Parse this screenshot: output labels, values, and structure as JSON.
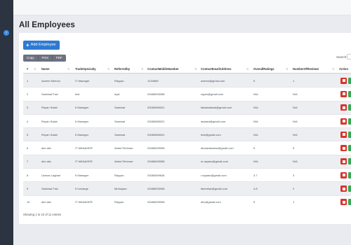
{
  "page": {
    "title": "All Employees"
  },
  "toolbar": {
    "add_label": "Add Employee",
    "exports": [
      "Copy",
      "Print",
      "PDF"
    ],
    "search_label": "Search:"
  },
  "table": {
    "headers": [
      "#",
      "Name",
      "TradeSpecialty",
      "Referredby",
      "ContactMobileNumber",
      "ContactEmailAddress",
      "OverallRatings",
      "NumberOfReviews",
      "Action"
    ],
    "rows": [
      [
        "1",
        "Azeem Memon",
        "IT Manager",
        "Rayyan",
        "1234565",
        "azeem@gmail.com",
        "5",
        "1"
      ],
      [
        "2",
        "Samiwal Faiz",
        "test",
        "riyal",
        "03486005058",
        "rayan@gmail.com",
        "N/A",
        "N/A"
      ],
      [
        "3",
        "Reyan Salah",
        "It Manager",
        "Samiwal",
        "03080585031",
        "faisaladawal@gmail.com",
        "N/A",
        "N/A"
      ],
      [
        "4",
        "Reyan Salah",
        "It Manager",
        "Samiwal",
        "03080585031",
        "asdasd@gmail.com",
        "N/A",
        "N/A"
      ],
      [
        "5",
        "Reyan Salah",
        "It Manager",
        "Samiwal",
        "03080585031",
        "test@gmail.com",
        "N/A",
        "N/A"
      ],
      [
        "6",
        "abc abc",
        "IT MANAGER",
        "Abdul Rehman",
        "03486005058",
        "abcasdasdaw@gmail.com",
        "5",
        "5"
      ],
      [
        "7",
        "abc abc",
        "IT MANAGER",
        "Abdul Rehman",
        "03486005058",
        "m.rayaan@gmail.com",
        "N/A",
        "N/A"
      ],
      [
        "8",
        "Usman Laghari",
        "It Manager",
        "Rayyan",
        "03080599636",
        "r.rayaan@gmail.com",
        "3.7",
        "3"
      ],
      [
        "9",
        "Samiwal Faiz",
        "It Incharge",
        "Mrzbayan",
        "03486005058",
        "faizmfaiz@gmail.com",
        "4.8",
        "2"
      ],
      [
        "10",
        "abc abc",
        "IT MANAGER",
        "Rayyan",
        "03486005058",
        "abc@gmail.com",
        "5",
        "1"
      ]
    ]
  },
  "footer": {
    "info": "Showing 1 to 10 of 11 entries"
  }
}
